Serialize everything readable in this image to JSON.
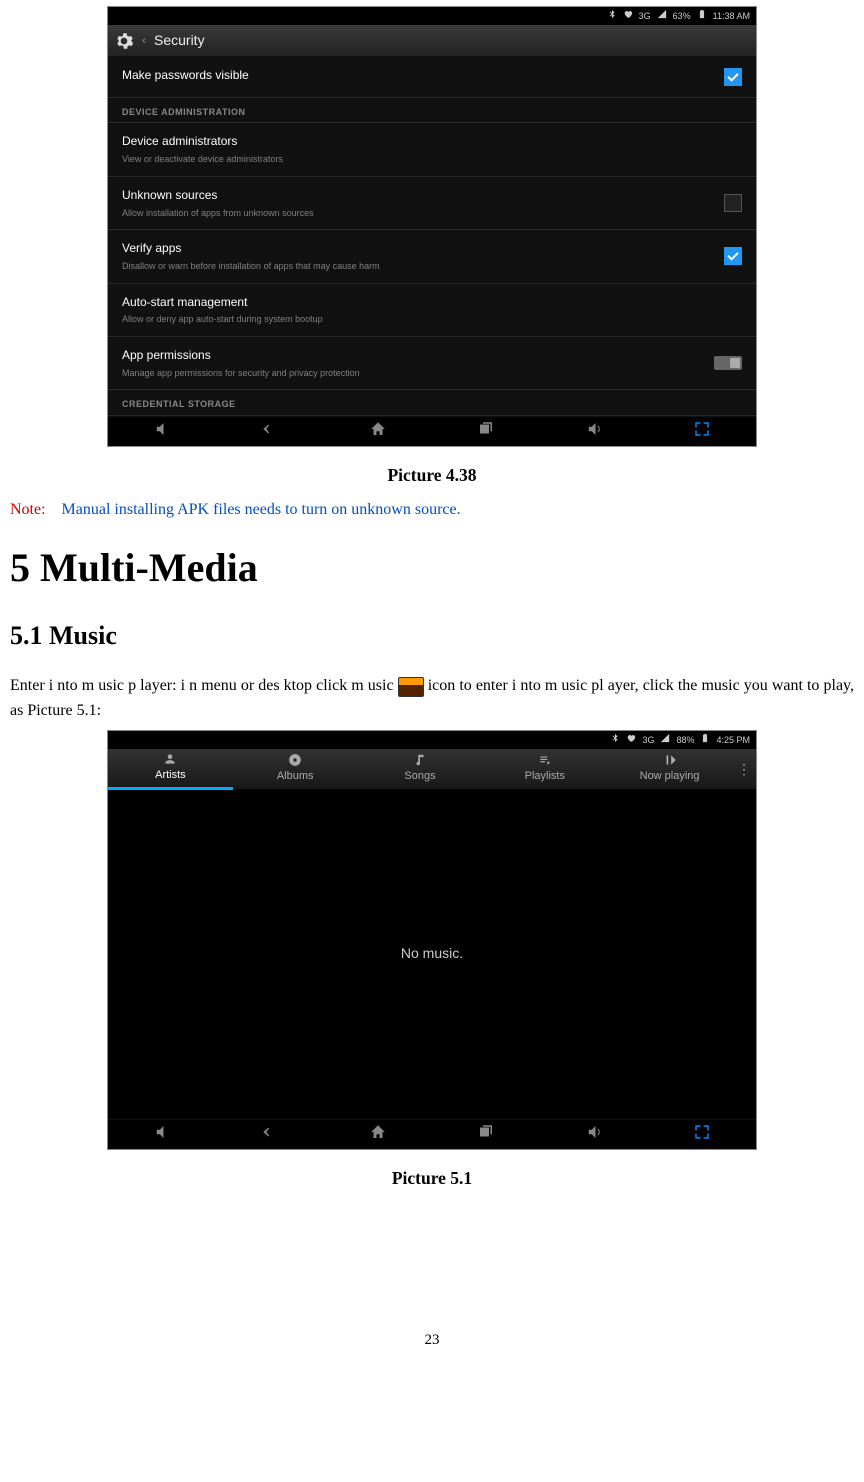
{
  "screenshot1": {
    "status": {
      "bluetooth": true,
      "heart": true,
      "network": "3G",
      "signal": true,
      "battery": "63%",
      "time": "11:38 AM"
    },
    "titlebar": {
      "title": "Security"
    },
    "rows": [
      {
        "label": "Make passwords visible",
        "sub": "",
        "ctrl": "check-on"
      }
    ],
    "section1": "DEVICE ADMINISTRATION",
    "rows2": [
      {
        "label": "Device administrators",
        "sub": "View or deactivate device administrators",
        "ctrl": "none"
      },
      {
        "label": "Unknown sources",
        "sub": "Allow installation of apps from unknown sources",
        "ctrl": "check-off"
      },
      {
        "label": "Verify apps",
        "sub": "Disallow or warn before installation of apps that may cause harm",
        "ctrl": "check-on"
      },
      {
        "label": "Auto-start management",
        "sub": "Allow or deny app auto-start during system bootup",
        "ctrl": "none"
      },
      {
        "label": "App permissions",
        "sub": "Manage app permissions for security and privacy protection",
        "ctrl": "toggle"
      }
    ],
    "section2": "CREDENTIAL STORAGE"
  },
  "caption1": "Picture 4.38",
  "note": {
    "label": "Note:",
    "body": "Manual installing APK files needs to turn on unknown source."
  },
  "chapter": "5 Multi-Media",
  "section": "5.1 Music",
  "para": {
    "p1a": "Enter i nto m usic p layer: i n  menu or des ktop  click m usic ",
    "p1b": " icon  to  enter i nto m usic pl ayer, click the music you want to play, as Picture 5.1:"
  },
  "screenshot2": {
    "status": {
      "bluetooth": true,
      "heart": true,
      "network": "3G",
      "signal": true,
      "battery": "88%",
      "time": "4:25 PM"
    },
    "tabs": [
      {
        "label": "Artists",
        "active": true
      },
      {
        "label": "Albums",
        "active": false
      },
      {
        "label": "Songs",
        "active": false
      },
      {
        "label": "Playlists",
        "active": false
      },
      {
        "label": "Now playing",
        "active": false
      }
    ],
    "body": "No music."
  },
  "caption2": "Picture 5.1",
  "pageNumber": "23"
}
